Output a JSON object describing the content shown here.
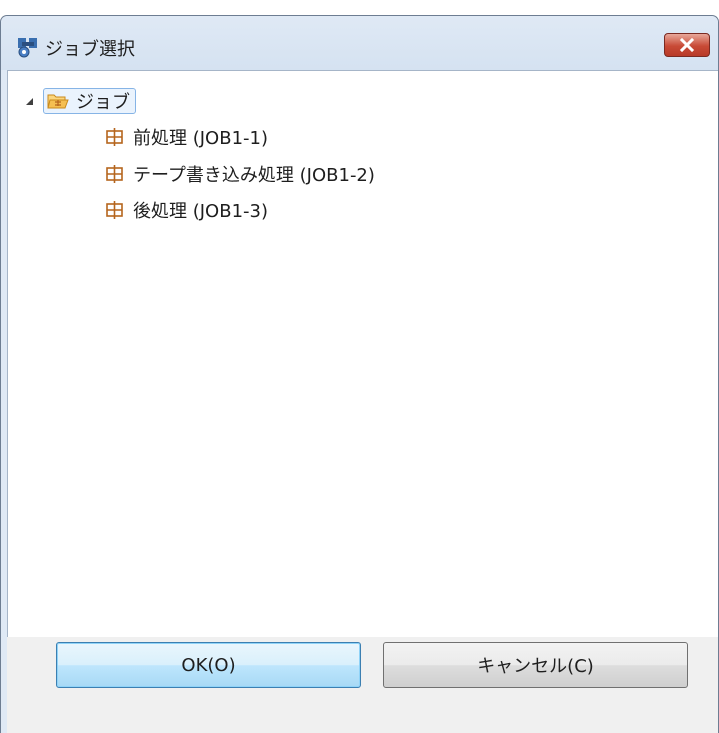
{
  "window": {
    "title": "ジョブ選択",
    "close_icon": "close-x-icon"
  },
  "tree": {
    "root": {
      "label": "ジョブ",
      "icon": "open-folder-icon",
      "expanded": true,
      "selected": true
    },
    "children": [
      {
        "label": "前処理 (JOB1-1)",
        "icon": "job-icon"
      },
      {
        "label": "テープ書き込み処理 (JOB1-2)",
        "icon": "job-icon"
      },
      {
        "label": "後処理 (JOB1-3)",
        "icon": "job-icon"
      }
    ]
  },
  "buttons": {
    "ok_label": "OK(O)",
    "cancel_label": "キャンセル(C)"
  },
  "colors": {
    "close_button": "#c84a36",
    "job_icon": "#b5651d",
    "folder_icon": "#e9a23b",
    "selection_border": "#86b4e6"
  }
}
